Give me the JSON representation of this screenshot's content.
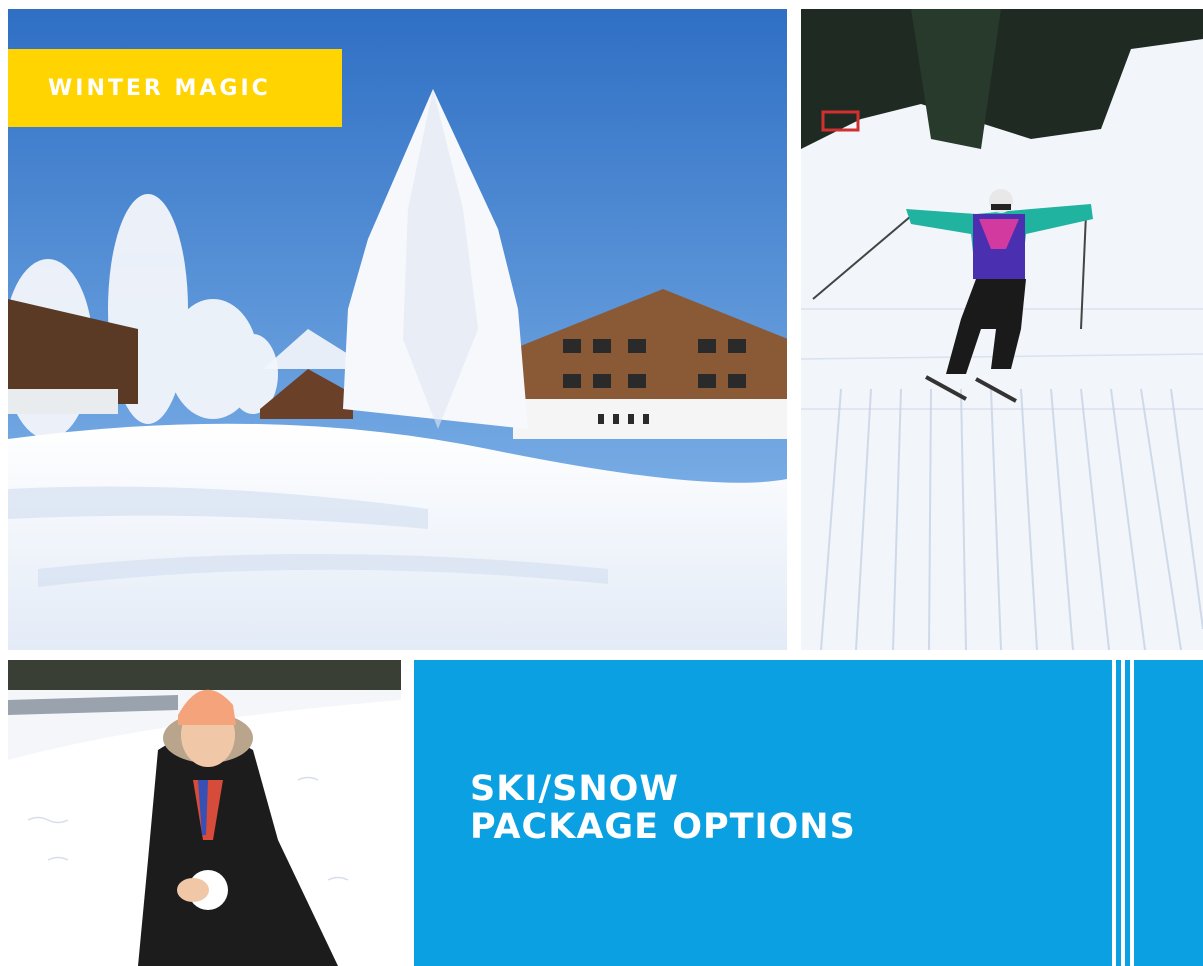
{
  "badge": {
    "label": "WINTER MAGIC"
  },
  "panel": {
    "title_line1": "SKI/SNOW",
    "title_line2": "PACKAGE OPTIONS"
  },
  "colors": {
    "badge_bg": "#ffd400",
    "panel_bg": "#0ba0e1",
    "sky": "#3f86d6",
    "snow": "#f4f7fc",
    "text": "#ffffff"
  },
  "photos": [
    {
      "subject": "snowy-chalet-with-frosted-trees"
    },
    {
      "subject": "skier-on-groomed-slope"
    },
    {
      "subject": "girl-making-snowball"
    }
  ]
}
